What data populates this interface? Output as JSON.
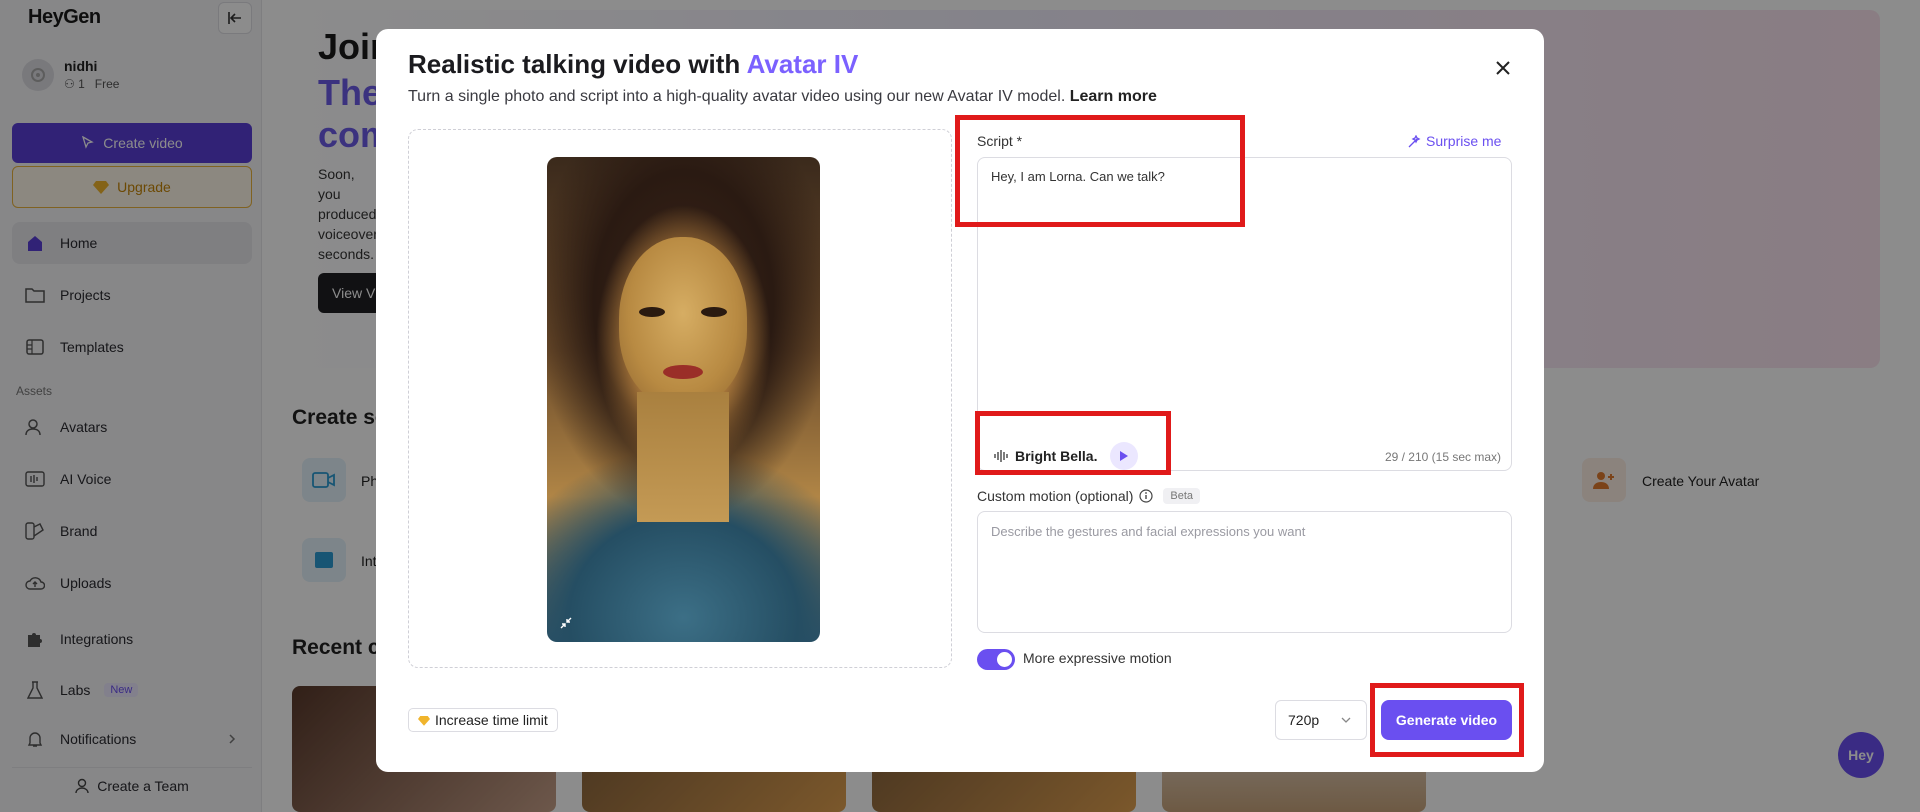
{
  "app": {
    "logo": "HeyGen"
  },
  "user": {
    "name": "nidhi",
    "seats": "1",
    "plan": "Free"
  },
  "sidebar": {
    "create_video": "Create video",
    "upgrade": "Upgrade",
    "section_assets": "Assets",
    "items": [
      {
        "label": "Home"
      },
      {
        "label": "Projects"
      },
      {
        "label": "Templates"
      },
      {
        "label": "Avatars"
      },
      {
        "label": "AI Voice"
      },
      {
        "label": "Brand"
      },
      {
        "label": "Uploads"
      },
      {
        "label": "Integrations"
      },
      {
        "label": "Labs",
        "badge": "New"
      },
      {
        "label": "Notifications"
      }
    ],
    "create_team": "Create a Team"
  },
  "background": {
    "hero_title": "Join",
    "hero_sub_1": "The",
    "hero_sub_2": "com",
    "hero_text": "Soon, you produced voiceover seconds.",
    "hero_button": "View V",
    "section_create": "Create so",
    "card_1": "Ph",
    "card_2": "Int",
    "card_avatar": "Create Your Avatar",
    "section_recent": "Recent cr",
    "fab": "Hey"
  },
  "modal": {
    "title_plain": "Realistic talking video with ",
    "title_accent": "Avatar IV",
    "subtitle": "Turn a single photo and script into a high-quality avatar video using our new Avatar IV model.",
    "learn_more": "Learn more",
    "script_label": "Script *",
    "surprise_me": "Surprise me",
    "script_value": "Hey, I am Lorna. Can we talk?",
    "voice_name": "Bright Bella.",
    "char_counter": "29 / 210 (15 sec max)",
    "motion_label": "Custom motion (optional)",
    "beta": "Beta",
    "motion_placeholder": "Describe the gestures and facial expressions you want",
    "expressive_label": "More expressive motion",
    "expressive_on": true,
    "increase_time": "Increase time limit",
    "resolution": "720p",
    "generate": "Generate video"
  },
  "colors": {
    "brand": "#6a4ff0",
    "highlight": "#e01a1a",
    "upgrade": "#e9b23d"
  }
}
